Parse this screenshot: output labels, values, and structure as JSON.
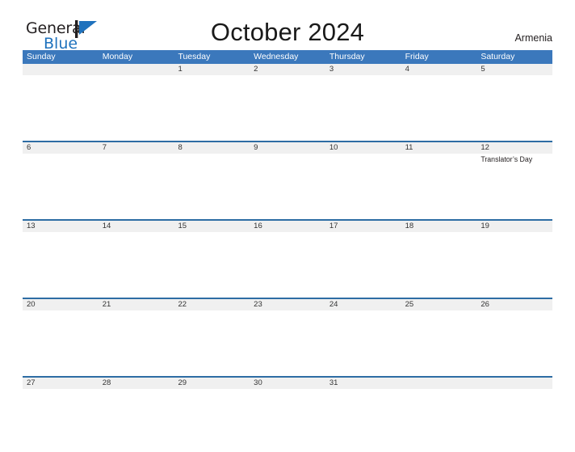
{
  "brand": {
    "name_part1": "General",
    "name_part2": "Blue",
    "flag_icon": "flag-triangle-icon",
    "accent_color": "#1f72bd"
  },
  "header": {
    "title": "October 2024",
    "location": "Armenia"
  },
  "colors": {
    "weekday_header_bg": "#3b78bc",
    "week_divider": "#2e6da4",
    "date_stripe_bg": "#f0f0f0",
    "text": "#231f20"
  },
  "calendar": {
    "month": "October",
    "year": "2024",
    "weekday_headers": [
      "Sunday",
      "Monday",
      "Tuesday",
      "Wednesday",
      "Thursday",
      "Friday",
      "Saturday"
    ],
    "weeks": [
      {
        "days": [
          {
            "date": "",
            "events": []
          },
          {
            "date": "",
            "events": []
          },
          {
            "date": "1",
            "events": []
          },
          {
            "date": "2",
            "events": []
          },
          {
            "date": "3",
            "events": []
          },
          {
            "date": "4",
            "events": []
          },
          {
            "date": "5",
            "events": []
          }
        ]
      },
      {
        "days": [
          {
            "date": "6",
            "events": []
          },
          {
            "date": "7",
            "events": []
          },
          {
            "date": "8",
            "events": []
          },
          {
            "date": "9",
            "events": []
          },
          {
            "date": "10",
            "events": []
          },
          {
            "date": "11",
            "events": []
          },
          {
            "date": "12",
            "events": [
              "Translator’s Day"
            ]
          }
        ]
      },
      {
        "days": [
          {
            "date": "13",
            "events": []
          },
          {
            "date": "14",
            "events": []
          },
          {
            "date": "15",
            "events": []
          },
          {
            "date": "16",
            "events": []
          },
          {
            "date": "17",
            "events": []
          },
          {
            "date": "18",
            "events": []
          },
          {
            "date": "19",
            "events": []
          }
        ]
      },
      {
        "days": [
          {
            "date": "20",
            "events": []
          },
          {
            "date": "21",
            "events": []
          },
          {
            "date": "22",
            "events": []
          },
          {
            "date": "23",
            "events": []
          },
          {
            "date": "24",
            "events": []
          },
          {
            "date": "25",
            "events": []
          },
          {
            "date": "26",
            "events": []
          }
        ]
      },
      {
        "days": [
          {
            "date": "27",
            "events": []
          },
          {
            "date": "28",
            "events": []
          },
          {
            "date": "29",
            "events": []
          },
          {
            "date": "30",
            "events": []
          },
          {
            "date": "31",
            "events": []
          },
          {
            "date": "",
            "events": []
          },
          {
            "date": "",
            "events": []
          }
        ]
      }
    ]
  }
}
